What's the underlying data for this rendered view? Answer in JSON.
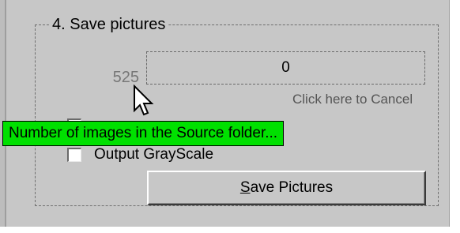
{
  "groupbox": {
    "title": "4. Save pictures",
    "image_count": "525",
    "progress_value": "0",
    "cancel_hint": "Click here to Cancel",
    "checkbox_hidden": {
      "label": "",
      "checked": false
    },
    "checkbox_grayscale": {
      "label": "Output GrayScale",
      "checked": false
    },
    "save_button": {
      "mnemonic": "S",
      "rest": "ave Pictures"
    }
  },
  "tooltip": {
    "text": "Number of images in the Source folder..."
  },
  "icons": {
    "cursor": "arrow-cursor-icon"
  },
  "colors": {
    "window_bg": "#c7c7c7",
    "tooltip_bg": "#00e000"
  }
}
